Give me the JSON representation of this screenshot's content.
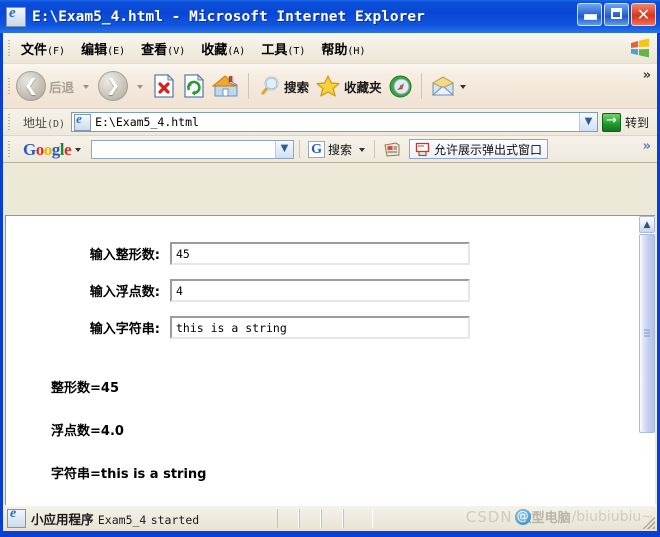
{
  "window": {
    "title": "E:\\Exam5_4.html - Microsoft Internet Explorer",
    "minimize_label": "Minimize",
    "maximize_label": "Maximize",
    "close_label": "Close"
  },
  "menubar": {
    "items": [
      {
        "name": "文件",
        "key": "(F)"
      },
      {
        "name": "编辑",
        "key": "(E)"
      },
      {
        "name": "查看",
        "key": "(V)"
      },
      {
        "name": "收藏",
        "key": "(A)"
      },
      {
        "name": "工具",
        "key": "(T)"
      },
      {
        "name": "帮助",
        "key": "(H)"
      }
    ],
    "logo_icon": "windows-flag-icon"
  },
  "toolbar": {
    "back_label": "后退",
    "forward_label": "",
    "stop_icon": "stop-page-icon",
    "refresh_icon": "refresh-page-icon",
    "home_icon": "home-icon",
    "search_label": "搜索",
    "search_icon": "magnifier-icon",
    "favorites_label": "收藏夹",
    "favorites_icon": "star-icon",
    "media_icon": "media-compass-icon",
    "mail_icon": "mail-envelope-icon",
    "overflow_label": "»"
  },
  "address": {
    "label": "地址",
    "label_key": "(D)",
    "value": "E:\\Exam5_4.html",
    "dropdown_icon": "chevron-down-icon",
    "go_label": "转到",
    "go_icon": "go-arrow-icon"
  },
  "googlebar": {
    "logo_letters": [
      "G",
      "o",
      "o",
      "g",
      "l",
      "e"
    ],
    "query": "",
    "query_placeholder": "",
    "dropdown_icon": "chevron-down-icon",
    "search_label": "搜索",
    "g_mark": "G",
    "news_icon": "news-icon",
    "popup_blocker_label": "允许展示弹出式窗口",
    "popup_blocker_icon": "popup-blocker-icon",
    "overflow_label": "»"
  },
  "page": {
    "fields": [
      {
        "label": "输入整形数:",
        "value": "45"
      },
      {
        "label": "输入浮点数:",
        "value": "4"
      },
      {
        "label": "输入字符串:",
        "value": "this is a string"
      }
    ],
    "outputs": [
      "整形数=45",
      "浮点数=4.0",
      "字符串=this is a string"
    ]
  },
  "scrollbar": {
    "up_icon": "chevron-up-icon",
    "down_icon": "chevron-down-icon",
    "thumb_label": "vertical-scroll-thumb"
  },
  "statusbar": {
    "applet_prefix": "小应用程序",
    "applet_name": "Exam5_4",
    "applet_state": "started",
    "watermark_brand": "CSDN",
    "watermark_user": "微型电脑",
    "watermark_tail": "/biubiubiu~"
  },
  "colors": {
    "title_blue": "#0a46d6",
    "chrome_beige": "#ece9d8",
    "toolbar_tan": "#f3e6d8",
    "page_white": "#ffffff",
    "close_red": "#d7351c",
    "go_green": "#1d9a2c"
  }
}
